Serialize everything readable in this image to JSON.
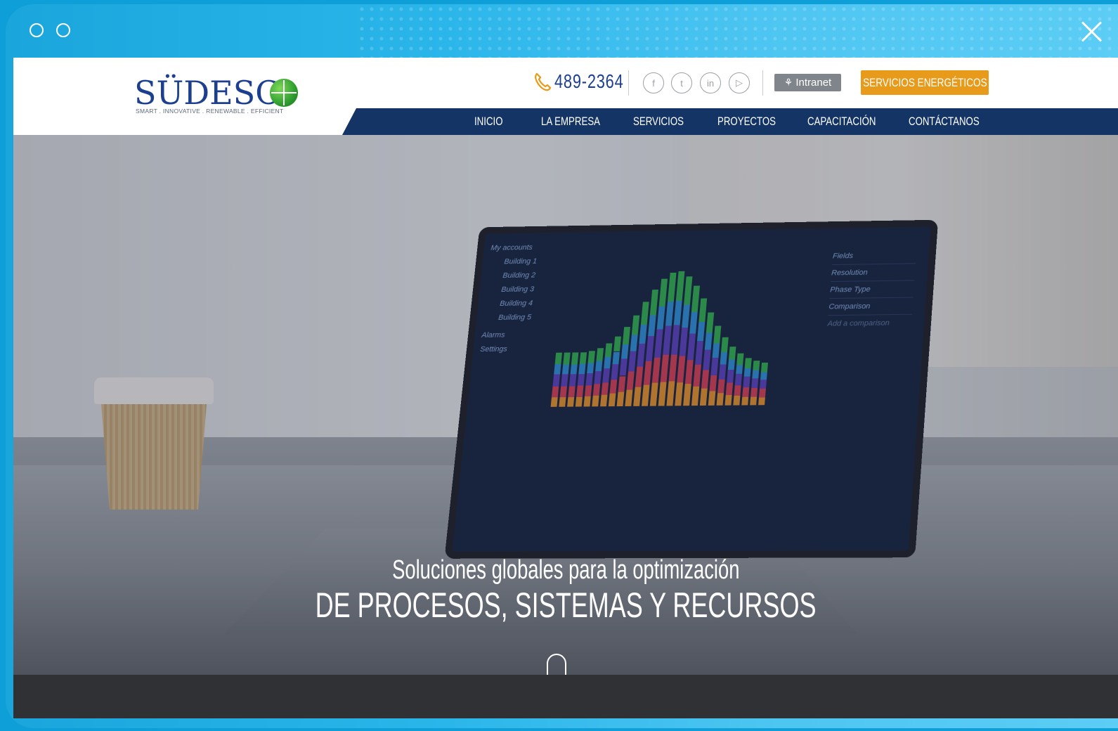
{
  "header": {
    "logo_text": "SÜDESC",
    "logo_tagline": "SMART . INNOVATIVE . RENEWABLE . EFFICIENT",
    "phone": "489-2364",
    "intranet_label": "Intranet",
    "cta_label": "SERVICIOS ENERGÉTICOS"
  },
  "nav": {
    "items": [
      "INICIO",
      "LA EMPRESA",
      "SERVICIOS",
      "PROYECTOS",
      "CAPACITACIÓN",
      "CONTÁCTANOS"
    ]
  },
  "hero": {
    "line1": "Soluciones globales para la optimización",
    "line2": "DE PROCESOS, SISTEMAS Y RECURSOS"
  },
  "screen": {
    "sidebar": [
      "My accounts",
      "Building 1",
      "Building 2",
      "Building 3",
      "Building 4",
      "Building 5",
      "Alarms",
      "Settings"
    ],
    "panel": [
      "Fields",
      "Resolution",
      "Phase Type",
      "Comparison",
      "Add a comparison"
    ]
  },
  "icons": {
    "phone": "phone-icon",
    "social": [
      "facebook-icon",
      "twitter-icon",
      "linkedin-icon",
      "youtube-icon"
    ],
    "intranet": "network-icon",
    "close": "close-icon"
  },
  "colors": {
    "brand_blue": "#133464",
    "accent_orange": "#e89a1a",
    "window_frame": "#2bb6ea"
  }
}
